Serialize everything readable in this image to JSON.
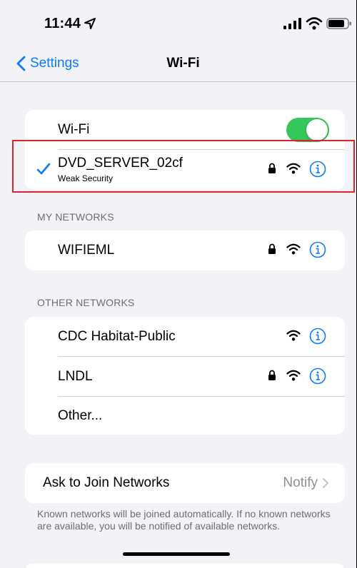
{
  "status_bar": {
    "time": "11:44",
    "icons": [
      "location-arrow-icon",
      "signal-icon",
      "wifi-icon",
      "battery-icon"
    ]
  },
  "nav": {
    "back_label": "Settings",
    "title": "Wi-Fi"
  },
  "wifi": {
    "toggle_label": "Wi-Fi",
    "toggle_on": true,
    "connected": {
      "name": "DVD_SERVER_02cf",
      "subtitle": "Weak Security",
      "secured": true
    }
  },
  "my_networks": {
    "header": "MY NETWORKS",
    "items": [
      {
        "name": "WIFIEML",
        "secured": true
      }
    ]
  },
  "other_networks": {
    "header": "OTHER NETWORKS",
    "items": [
      {
        "name": "CDC Habitat-Public",
        "secured": false
      },
      {
        "name": "LNDL",
        "secured": true
      }
    ],
    "other_label": "Other..."
  },
  "ask_to_join": {
    "label": "Ask to Join Networks",
    "value": "Notify",
    "description": "Known networks will be joined automatically. If no known networks are available, you will be notified of available networks."
  },
  "colors": {
    "accent": "#0a7aff",
    "toggle_on": "#34c759",
    "highlight": "#e0232a",
    "background": "#f2f2f7"
  }
}
